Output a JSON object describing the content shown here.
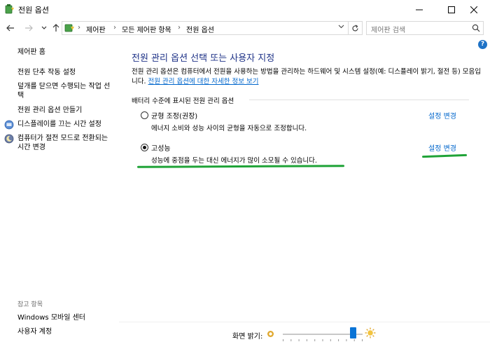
{
  "window": {
    "title": "전원 옵션"
  },
  "address": {
    "crumbs": [
      "제어판",
      "모든 제어판 항목",
      "전원 옵션"
    ],
    "search_placeholder": "제어판 검색"
  },
  "sidebar": {
    "home": "제어판 홈",
    "items": [
      "전원 단추 작동 설정",
      "덮개를 닫으면 수행되는 작업 선택",
      "전원 관리 옵션 만들기",
      "디스플레이를 끄는 시간 설정",
      "컴퓨터가 절전 모드로 전환되는 시간 변경"
    ],
    "see_also_label": "참고 항목",
    "see_also": [
      "Windows 모바일 센터",
      "사용자 계정"
    ]
  },
  "main": {
    "title": "전원 관리 옵션 선택 또는 사용자 지정",
    "description": "전원 관리 옵션은 컴퓨터에서 전원을 사용하는 방법을 관리하는 하드웨어 및 시스템 설정(예: 디스플레이 밝기, 절전 등) 모음입니다.",
    "description_link": "전원 관리 옵션에 대한 자세한 정보 보기",
    "group_label": "배터리 수준에 표시된 전원 관리 옵션",
    "plans": [
      {
        "name": "균형 조정(권장)",
        "description": "에너지 소비와 성능 사이의 균형을 자동으로 조정합니다.",
        "link": "설정 변경",
        "selected": false
      },
      {
        "name": "고성능",
        "description": "성능에 중점을 두는 대신 에너지가 많이 소모될 수 있습니다.",
        "link": "설정 변경",
        "selected": true
      }
    ]
  },
  "brightness": {
    "label": "화면 밝기:",
    "value_fraction": 0.88
  },
  "colors": {
    "title_blue": "#1e3287",
    "link_blue": "#0066cc",
    "highlight_green": "#1fa337",
    "slider_blue": "#0a74d6"
  }
}
